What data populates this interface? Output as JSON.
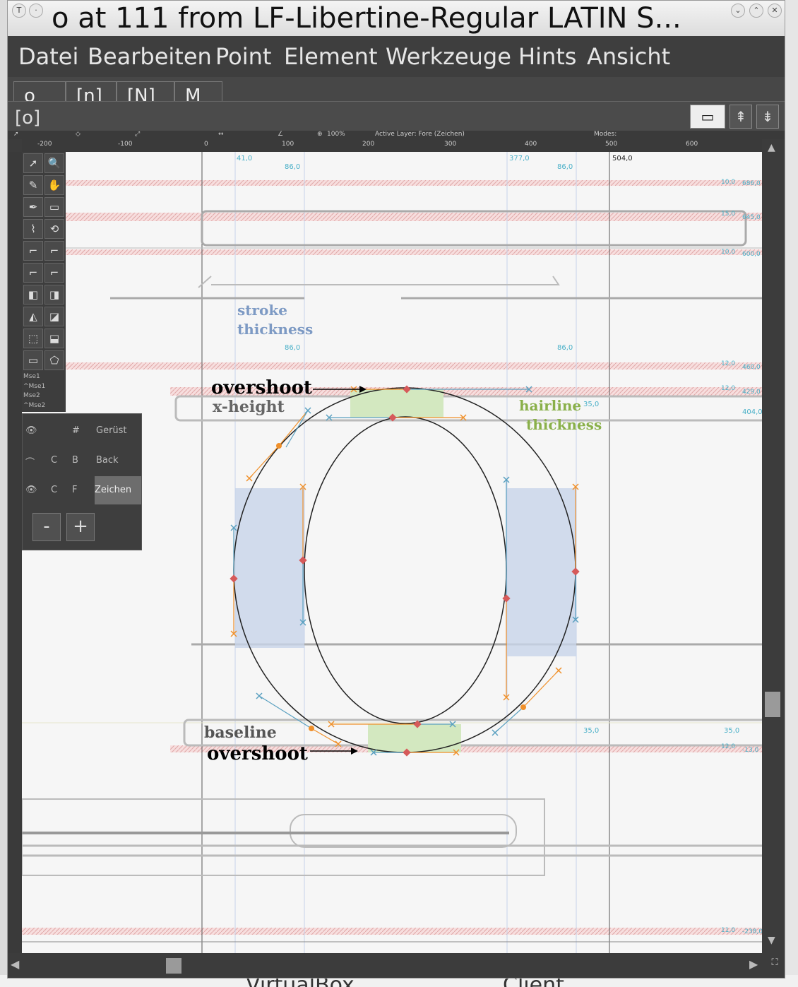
{
  "window": {
    "title": "o at 111 from LF-Libertine-Regular LATIN S...",
    "controls": [
      "⌄",
      "⌃",
      "✕"
    ]
  },
  "menu": [
    "Datei",
    "Bearbeiten",
    "Point",
    "Element",
    "Werkzeuge",
    "Hints",
    "Ansicht"
  ],
  "tabs": [
    "o",
    "[n]",
    "[N]",
    "M"
  ],
  "infobar": {
    "glyph": "[o]",
    "buttons": [
      "▭",
      "⇞",
      "⇟"
    ]
  },
  "statusbar": {
    "zoom": "100%",
    "active_layer": "Active Layer: Fore (Zeichen)",
    "modes": "Modes:"
  },
  "ruler": {
    "ticks": [
      "-200",
      "-100",
      "0",
      "100",
      "200",
      "300",
      "400",
      "500",
      "600"
    ]
  },
  "measurements": {
    "top_left": "41,0",
    "top_mid_left": "86,0",
    "top_right": "377,0",
    "top_mid_right": "86,0",
    "advance": "504,0",
    "stroke_left": "86,0",
    "stroke_right": "86,0",
    "hairline_top": "35,0",
    "hairline_bottom": "35,0",
    "baseline_right": "35,0",
    "xheight_right": "404,0"
  },
  "zones": [
    {
      "label": "10,0",
      "value": "686,0"
    },
    {
      "label": "15,0",
      "value": "645,0"
    },
    {
      "label": "10,0",
      "value": "600,0"
    },
    {
      "label": "12,0",
      "value": "460,0"
    },
    {
      "label": "12,0",
      "value": "429,0"
    },
    {
      "label": "12,0",
      "value": "-13,0"
    },
    {
      "label": "11,0",
      "value": "-238,0"
    }
  ],
  "annotations": {
    "overshoot_top": "overshoot",
    "x_height": "x-height",
    "stroke": "stroke",
    "thickness": "thickness",
    "hairline": "hairline",
    "hairline_thickness": "thickness",
    "baseline": "baseline",
    "overshoot_bottom": "overshoot"
  },
  "tools": [
    "➚",
    "🔍",
    "✎",
    "✋",
    "✒",
    "▭",
    "⌇",
    "⟲",
    "⌐",
    "⌐",
    "⌐",
    "⌐",
    "◧",
    "◨",
    "◭",
    "◪",
    "⬚",
    "⬓",
    "▭",
    "⬠"
  ],
  "mse": [
    "Mse1",
    "^Mse1",
    "Mse2",
    "^Mse2"
  ],
  "layers": {
    "rows": [
      {
        "c": "",
        "f": "#",
        "name": "Gerüst"
      },
      {
        "c": "C",
        "f": "B",
        "name": "Back"
      },
      {
        "c": "C",
        "f": "F",
        "name": "Zeichen"
      }
    ],
    "minus": "-",
    "plus": "+"
  },
  "desktop_bottom": [
    "VirtualBox",
    "Client"
  ],
  "colors": {
    "accent_blue": "#5aa0c0",
    "orange": "#f0902a",
    "hairline_green": "#8ab04a",
    "stroke_blue": "#7d9ac4"
  }
}
